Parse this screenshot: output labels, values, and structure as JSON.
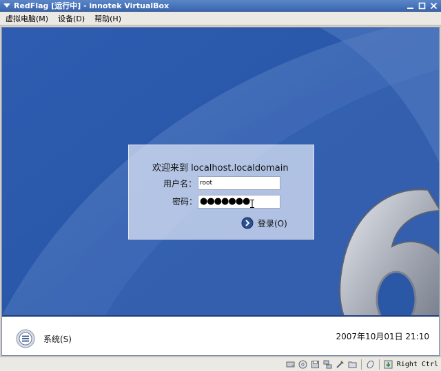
{
  "window": {
    "title": "RedFlag [运行中] - innotek VirtualBox",
    "title_color": "#3a66b0"
  },
  "menubar": {
    "items": [
      {
        "label": "虚拟电脑(M)"
      },
      {
        "label": "设备(D)"
      },
      {
        "label": "帮助(H)"
      }
    ]
  },
  "vm": {
    "background_color": "#2a57a6",
    "logo_digit": "6",
    "login": {
      "title": "欢迎来到 localhost.localdomain",
      "username_label": "用户名：",
      "username_value": "root",
      "password_label": "密码：",
      "password_mask": "●●●●●●●",
      "login_button": "登录(O)"
    },
    "bottom": {
      "system_label": "系统(S)",
      "clock": "2007年10月01日 21:10"
    }
  },
  "statusbar": {
    "icons": [
      "hdd-icon",
      "cdrom-icon",
      "floppy-icon",
      "network-icon",
      "usb-icon",
      "shared-folder-icon",
      "mouse-integration-icon",
      "host-key-icon"
    ],
    "host_key_label": "Right Ctrl"
  }
}
